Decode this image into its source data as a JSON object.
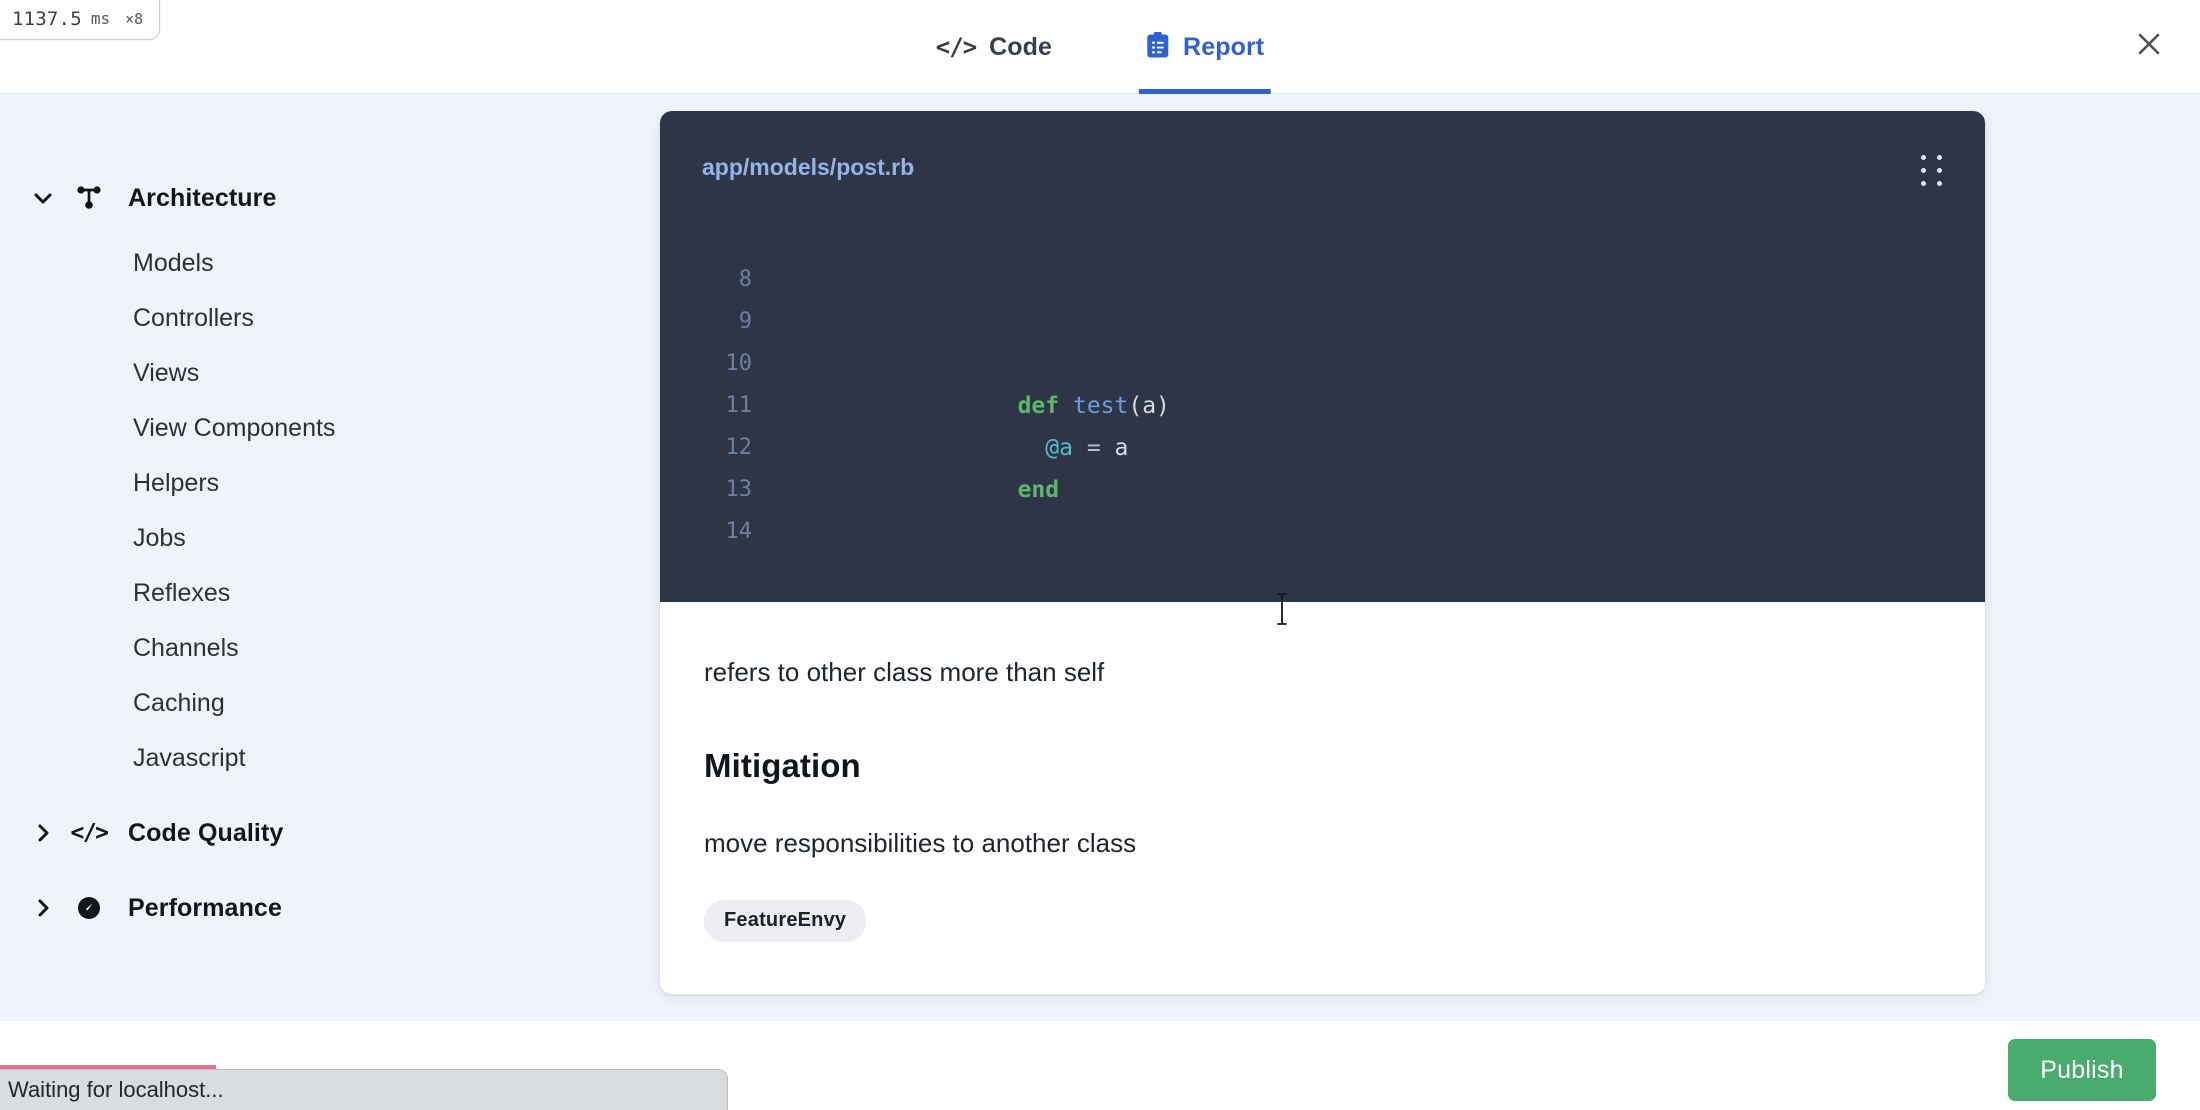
{
  "perf_badge": {
    "value": "1137.5",
    "unit": "ms",
    "count": "×8"
  },
  "header": {
    "tabs": [
      {
        "label": "Code",
        "icon": "code-icon",
        "active": false
      },
      {
        "label": "Report",
        "icon": "clipboard-report-icon",
        "active": true
      }
    ],
    "close_icon": "close-icon"
  },
  "sidebar": {
    "groups": [
      {
        "label": "Architecture",
        "icon": "sitemap-icon",
        "chevron": "chevron-down-icon",
        "expanded": true,
        "items": [
          {
            "label": "Models"
          },
          {
            "label": "Controllers"
          },
          {
            "label": "Views"
          },
          {
            "label": "View Components"
          },
          {
            "label": "Helpers"
          },
          {
            "label": "Jobs"
          },
          {
            "label": "Reflexes"
          },
          {
            "label": "Channels"
          },
          {
            "label": "Caching"
          },
          {
            "label": "Javascript"
          }
        ]
      },
      {
        "label": "Code Quality",
        "icon": "code-icon",
        "chevron": "chevron-right-icon",
        "expanded": false,
        "items": []
      },
      {
        "label": "Performance",
        "icon": "gauge-icon",
        "chevron": "chevron-right-icon",
        "expanded": false,
        "items": []
      }
    ]
  },
  "card": {
    "file_path": "app/models/post.rb",
    "drag_handle_icon": "drag-handle-icon",
    "code_lines": [
      {
        "number": "8",
        "tokens": []
      },
      {
        "number": "9",
        "tokens": []
      },
      {
        "number": "10",
        "tokens": [
          {
            "text": "def",
            "type": "kw"
          },
          {
            "text": " ",
            "type": "pl"
          },
          {
            "text": "test",
            "type": "fn"
          },
          {
            "text": "(a)",
            "type": "pl"
          }
        ]
      },
      {
        "number": "11",
        "tokens": [
          {
            "text": "  ",
            "type": "pl"
          },
          {
            "text": "@a",
            "type": "ivar"
          },
          {
            "text": " ",
            "type": "pl"
          },
          {
            "text": "=",
            "type": "op"
          },
          {
            "text": " a",
            "type": "pl"
          }
        ]
      },
      {
        "number": "12",
        "tokens": [
          {
            "text": "end",
            "type": "kw"
          }
        ]
      },
      {
        "number": "13",
        "tokens": []
      },
      {
        "number": "14",
        "tokens": []
      }
    ],
    "description": "refers to other class more than self",
    "mitigation_title": "Mitigation",
    "mitigation_text": "move responsibilities to another class",
    "smell_badge": "FeatureEnvy"
  },
  "footer": {
    "publish_label": "Publish"
  },
  "browser_status": {
    "text": "Waiting for localhost..."
  },
  "colors": {
    "accent_blue": "#2f62d0",
    "page_bg": "#eff3fb",
    "code_bg": "#2e3546",
    "publish_green": "#49ab6e",
    "file_path_blue": "#93b4e8",
    "keyword_green": "#5db66b",
    "ivar_cyan": "#4fc1c9",
    "loadbar_pink": "#e2738f"
  }
}
